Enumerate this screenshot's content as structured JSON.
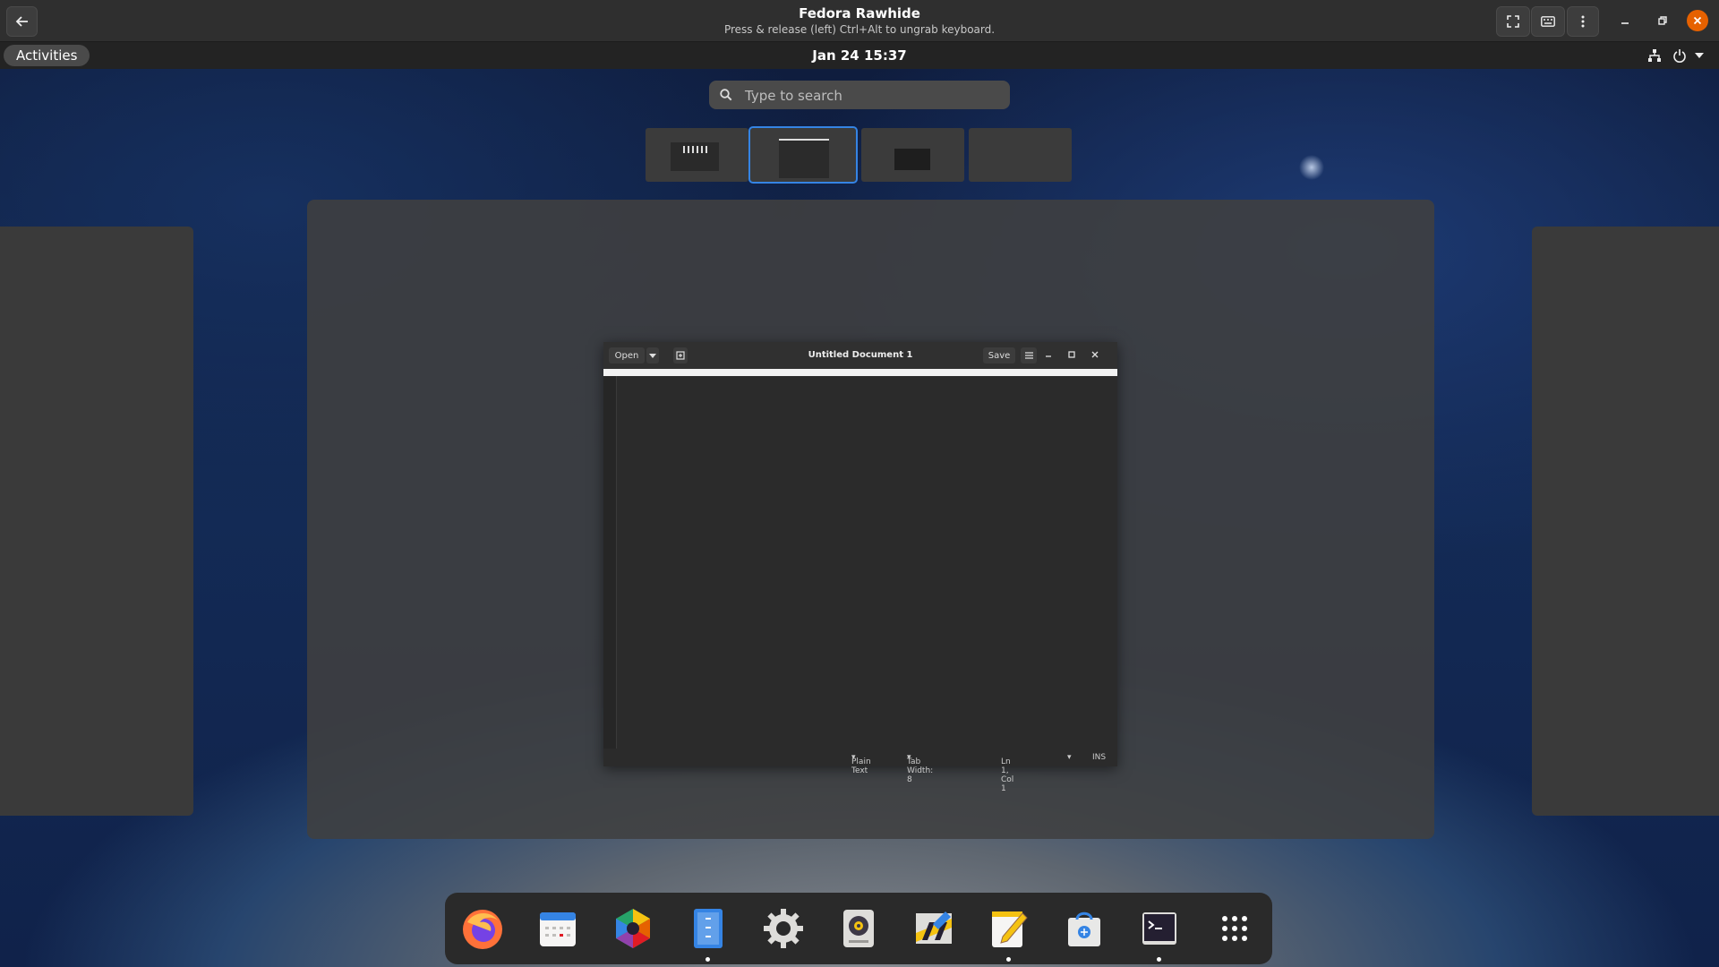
{
  "vm_header": {
    "title": "Fedora Rawhide",
    "subtitle": "Press & release (left) Ctrl+Alt to ungrab keyboard.",
    "icons": [
      "back-arrow-icon",
      "fullscreen-icon",
      "keyboard-icon",
      "kebab-menu-icon",
      "minimize-icon",
      "restore-icon",
      "close-icon"
    ]
  },
  "topbar": {
    "activities": "Activities",
    "clock": "Jan 24  15:37"
  },
  "search": {
    "placeholder": "Type to search"
  },
  "editor": {
    "open": "Open",
    "title": "Untitled Document 1",
    "save": "Save",
    "status": {
      "language": "Plain Text",
      "tab_width": "Tab Width: 8",
      "position": "Ln 1, Col 1",
      "mode": "INS"
    }
  },
  "dock": {
    "items": [
      {
        "name": "firefox",
        "running": false
      },
      {
        "name": "calendar",
        "running": false
      },
      {
        "name": "photos",
        "running": false
      },
      {
        "name": "files",
        "running": true
      },
      {
        "name": "settings",
        "running": false
      },
      {
        "name": "rhythmbox",
        "running": false
      },
      {
        "name": "construction",
        "running": false
      },
      {
        "name": "text-editor",
        "running": true
      },
      {
        "name": "software",
        "running": false
      },
      {
        "name": "terminal",
        "running": true
      },
      {
        "name": "app-grid",
        "running": false
      }
    ]
  },
  "colors": {
    "accent": "#3584e4",
    "close": "#e66100"
  }
}
